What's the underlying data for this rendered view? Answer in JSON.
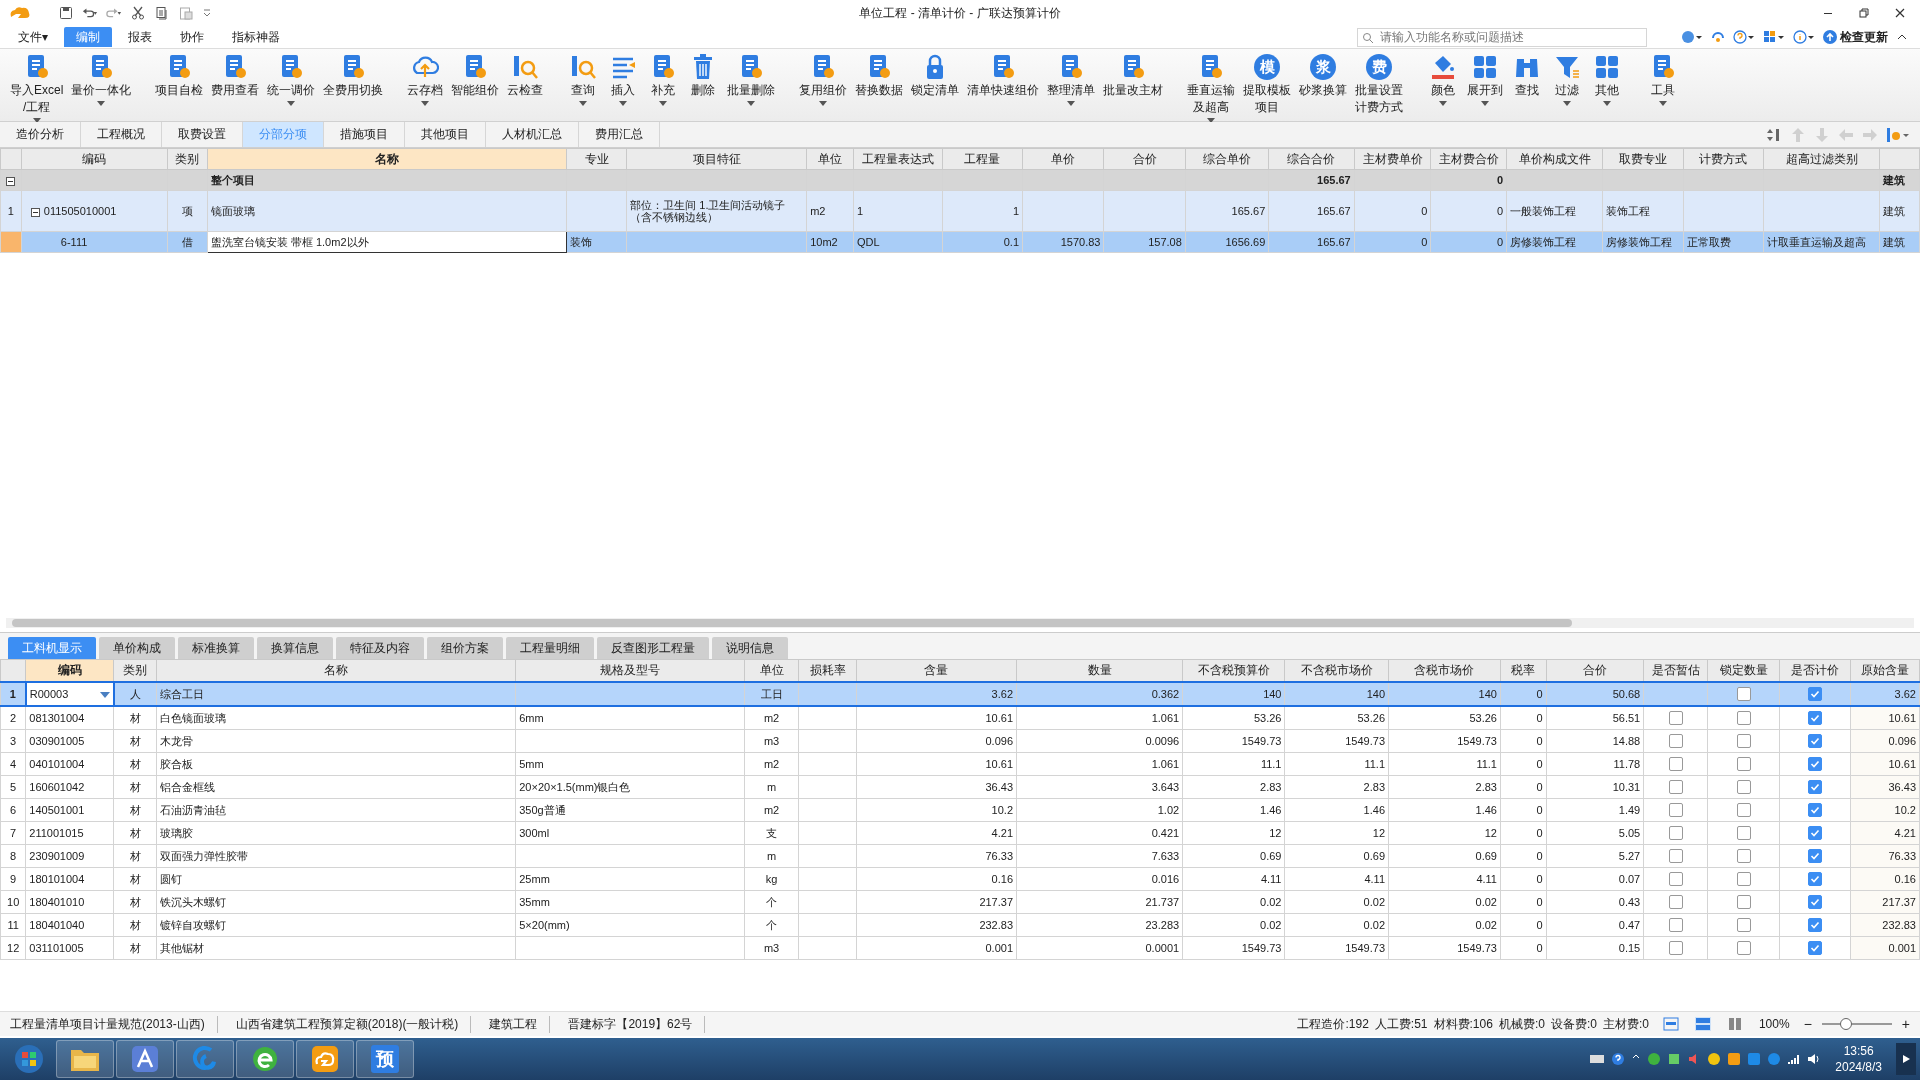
{
  "window": {
    "title": "单位工程 - 清单计价 - 广联达预算计价"
  },
  "menu": [
    {
      "label": "文件▾",
      "selected": false
    },
    {
      "label": "编制",
      "selected": true
    },
    {
      "label": "报表",
      "selected": false
    },
    {
      "label": "协作",
      "selected": false
    },
    {
      "label": "指标神器",
      "selected": false
    }
  ],
  "search": {
    "placeholder": "请输入功能名称或问题描述"
  },
  "update_button": "检查更新",
  "ribbon": [
    {
      "label": "导入Excel",
      "label_line2": "/工程",
      "caret": true
    },
    {
      "label": "量价一体化",
      "caret": true
    },
    {
      "label": "项目自检",
      "caret": false
    },
    {
      "label": "费用查看",
      "caret": false
    },
    {
      "label": "统一调价",
      "caret": true
    },
    {
      "label": "全费用切换",
      "caret": false
    },
    {
      "label": "云存档",
      "caret": true
    },
    {
      "label": "智能组价",
      "caret": false
    },
    {
      "label": "云检查",
      "caret": false
    },
    {
      "label": "查询",
      "caret": true
    },
    {
      "label": "插入",
      "caret": true
    },
    {
      "label": "补充",
      "caret": true
    },
    {
      "label": "删除",
      "caret": false
    },
    {
      "label": "批量删除",
      "caret": true
    },
    {
      "label": "复用组价",
      "caret": true
    },
    {
      "label": "替换数据",
      "caret": false
    },
    {
      "label": "锁定清单",
      "caret": false
    },
    {
      "label": "清单快速组价",
      "caret": false
    },
    {
      "label": "整理清单",
      "caret": true
    },
    {
      "label": "批量改主材",
      "caret": false
    },
    {
      "label": "垂直运输",
      "label_line2": "及超高",
      "caret": true
    },
    {
      "label": "提取模板",
      "label_line2": "项目",
      "caret": false,
      "glyph": "模"
    },
    {
      "label": "砂浆换算",
      "caret": false,
      "glyph": "浆"
    },
    {
      "label": "批量设置",
      "label_line2": "计费方式",
      "caret": false,
      "glyph": "费"
    },
    {
      "label": "颜色",
      "caret": true
    },
    {
      "label": "展开到",
      "caret": true
    },
    {
      "label": "查找",
      "caret": false
    },
    {
      "label": "过滤",
      "caret": true
    },
    {
      "label": "其他",
      "caret": true
    },
    {
      "label": "工具",
      "caret": true
    }
  ],
  "tabs": [
    {
      "label": "造价分析",
      "selected": false
    },
    {
      "label": "工程概况",
      "selected": false
    },
    {
      "label": "取费设置",
      "selected": false
    },
    {
      "label": "分部分项",
      "selected": true
    },
    {
      "label": "措施项目",
      "selected": false
    },
    {
      "label": "其他项目",
      "selected": false
    },
    {
      "label": "人材机汇总",
      "selected": false
    },
    {
      "label": "费用汇总",
      "selected": false
    }
  ],
  "top_table": {
    "columns": [
      "编码",
      "类别",
      "名称",
      "专业",
      "项目特征",
      "单位",
      "工程量表达式",
      "工程量",
      "单价",
      "合价",
      "综合单价",
      "综合合价",
      "主材费单价",
      "主材费合价",
      "单价构成文件",
      "取费专业",
      "计费方式",
      "超高过滤类别"
    ],
    "rows": [
      {
        "kind": "total",
        "expanded": true,
        "selected": false,
        "cells": [
          null,
          null,
          "整个项目",
          null,
          null,
          null,
          null,
          null,
          null,
          null,
          null,
          "165.67",
          null,
          "0",
          null,
          null,
          null,
          null,
          "建筑"
        ]
      },
      {
        "kind": "item",
        "num": "1",
        "expanded": true,
        "selected": false,
        "cells": [
          "011505010001",
          "项",
          "镜面玻璃",
          null,
          "部位：卫生间\n1.卫生间活动镜子（含不锈钢边线）",
          "m2",
          "1",
          "1",
          null,
          null,
          "165.67",
          "165.67",
          "0",
          "0",
          "一般装饰工程",
          "装饰工程",
          null,
          null,
          "建筑"
        ]
      },
      {
        "kind": "quota",
        "selected": true,
        "cells": [
          "6-111",
          "借",
          "盥洗室台镜安装 带框 1.0m2以外",
          "装饰",
          null,
          "10m2",
          "QDL",
          "0.1",
          "1570.83",
          "157.08",
          "1656.69",
          "165.67",
          "0",
          "0",
          "房修装饰工程",
          "房修装饰工程",
          "正常取费",
          "计取垂直运输及超高",
          "建筑"
        ]
      }
    ]
  },
  "lower_tabs": [
    {
      "label": "工料机显示",
      "selected": true
    },
    {
      "label": "单价构成",
      "selected": false
    },
    {
      "label": "标准换算",
      "selected": false
    },
    {
      "label": "换算信息",
      "selected": false
    },
    {
      "label": "特征及内容",
      "selected": false
    },
    {
      "label": "组价方案",
      "selected": false
    },
    {
      "label": "工程量明细",
      "selected": false
    },
    {
      "label": "反查图形工程量",
      "selected": false
    },
    {
      "label": "说明信息",
      "selected": false
    }
  ],
  "lower_table": {
    "columns": [
      "编码",
      "类别",
      "名称",
      "规格及型号",
      "单位",
      "损耗率",
      "含量",
      "数量",
      "不含税预算价",
      "不含税市场价",
      "含税市场价",
      "税率",
      "合价",
      "是否暂估",
      "锁定数量",
      "是否计价",
      "原始含量"
    ],
    "rows": [
      {
        "num": "1",
        "selected": true,
        "cells": [
          "R00003",
          "人",
          "综合工日",
          null,
          "工日",
          null,
          "3.62",
          "0.362",
          "140",
          "140",
          "140",
          "0",
          "50.68"
        ],
        "locked": false,
        "priced": true,
        "original": "3.62"
      },
      {
        "num": "2",
        "selected": false,
        "cells": [
          "081301004",
          "材",
          "白色镜面玻璃",
          "6mm",
          "m2",
          null,
          "10.61",
          "1.061",
          "53.26",
          "53.26",
          "53.26",
          "0",
          "56.51"
        ],
        "estimated": false,
        "locked": false,
        "priced": true,
        "original": "10.61"
      },
      {
        "num": "3",
        "selected": false,
        "cells": [
          "030901005",
          "材",
          "木龙骨",
          null,
          "m3",
          null,
          "0.096",
          "0.0096",
          "1549.73",
          "1549.73",
          "1549.73",
          "0",
          "14.88"
        ],
        "estimated": false,
        "locked": false,
        "priced": true,
        "original": "0.096"
      },
      {
        "num": "4",
        "selected": false,
        "cells": [
          "040101004",
          "材",
          "胶合板",
          "5mm",
          "m2",
          null,
          "10.61",
          "1.061",
          "11.1",
          "11.1",
          "11.1",
          "0",
          "11.78"
        ],
        "estimated": false,
        "locked": false,
        "priced": true,
        "original": "10.61"
      },
      {
        "num": "5",
        "selected": false,
        "cells": [
          "160601042",
          "材",
          "铝合金框线",
          "20×20×1.5(mm)银白色",
          "m",
          null,
          "36.43",
          "3.643",
          "2.83",
          "2.83",
          "2.83",
          "0",
          "10.31"
        ],
        "estimated": false,
        "locked": false,
        "priced": true,
        "original": "36.43"
      },
      {
        "num": "6",
        "selected": false,
        "cells": [
          "140501001",
          "材",
          "石油沥青油毡",
          "350g普通",
          "m2",
          null,
          "10.2",
          "1.02",
          "1.46",
          "1.46",
          "1.46",
          "0",
          "1.49"
        ],
        "estimated": false,
        "locked": false,
        "priced": true,
        "original": "10.2"
      },
      {
        "num": "7",
        "selected": false,
        "cells": [
          "211001015",
          "材",
          "玻璃胶",
          "300ml",
          "支",
          null,
          "4.21",
          "0.421",
          "12",
          "12",
          "12",
          "0",
          "5.05"
        ],
        "estimated": false,
        "locked": false,
        "priced": true,
        "original": "4.21"
      },
      {
        "num": "8",
        "selected": false,
        "cells": [
          "230901009",
          "材",
          "双面强力弹性胶带",
          null,
          "m",
          null,
          "76.33",
          "7.633",
          "0.69",
          "0.69",
          "0.69",
          "0",
          "5.27"
        ],
        "estimated": false,
        "locked": false,
        "priced": true,
        "original": "76.33"
      },
      {
        "num": "9",
        "selected": false,
        "cells": [
          "180101004",
          "材",
          "圆钉",
          "25mm",
          "kg",
          null,
          "0.16",
          "0.016",
          "4.11",
          "4.11",
          "4.11",
          "0",
          "0.07"
        ],
        "estimated": false,
        "locked": false,
        "priced": true,
        "original": "0.16"
      },
      {
        "num": "10",
        "selected": false,
        "cells": [
          "180401010",
          "材",
          "铁沉头木螺钉",
          "35mm",
          "个",
          null,
          "217.37",
          "21.737",
          "0.02",
          "0.02",
          "0.02",
          "0",
          "0.43"
        ],
        "estimated": false,
        "locked": false,
        "priced": true,
        "original": "217.37"
      },
      {
        "num": "11",
        "selected": false,
        "cells": [
          "180401040",
          "材",
          "镀锌自攻螺钉",
          "5×20(mm)",
          "个",
          null,
          "232.83",
          "23.283",
          "0.02",
          "0.02",
          "0.02",
          "0",
          "0.47"
        ],
        "estimated": false,
        "locked": false,
        "priced": true,
        "original": "232.83"
      },
      {
        "num": "12",
        "selected": false,
        "cells": [
          "031101005",
          "材",
          "其他锯材",
          null,
          "m3",
          null,
          "0.001",
          "0.0001",
          "1549.73",
          "1549.73",
          "1549.73",
          "0",
          "0.15"
        ],
        "estimated": false,
        "locked": false,
        "priced": true,
        "original": "0.001"
      }
    ]
  },
  "status_bar": {
    "left": [
      "工程量清单项目计量规范(2013-山西)",
      "山西省建筑工程预算定额(2018)(一般计税)",
      "建筑工程",
      "晋建标字【2019】62号"
    ],
    "summary": [
      "工程造价:192",
      "人工费:51",
      "材料费:106",
      "机械费:0",
      "设备费:0",
      "主材费:0"
    ],
    "zoom": "100%",
    "zoom_minus": "−",
    "zoom_plus": "+",
    "zoom_slider": {
      "level": 0.35
    }
  },
  "taskbar": {
    "apps": [
      {
        "kind": "folder"
      },
      {
        "kind": "letter-app"
      },
      {
        "kind": "swirl"
      },
      {
        "kind": "browser"
      },
      {
        "kind": "cloud"
      },
      {
        "kind": "glyph",
        "glyph": "预"
      }
    ],
    "time": "13:56",
    "date": "2024/8/3"
  }
}
